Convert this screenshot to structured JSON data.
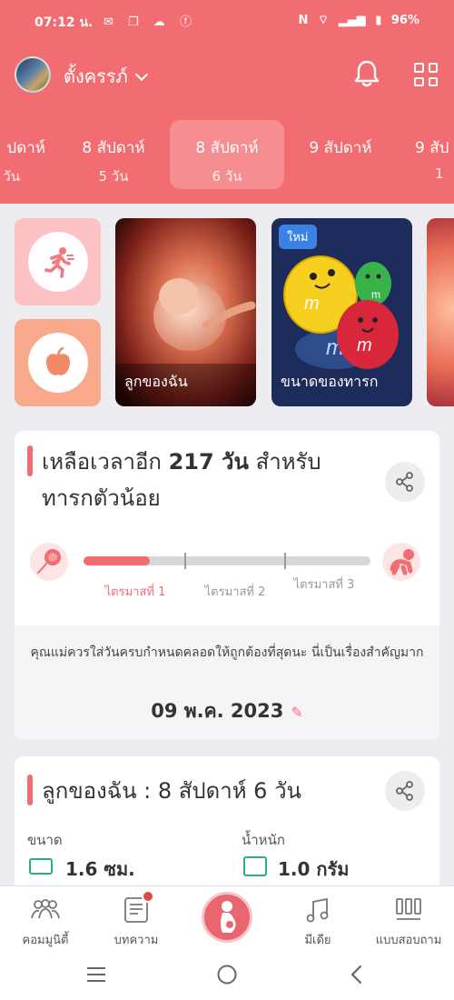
{
  "status_bar": {
    "time": "07:12 น.",
    "network": "N",
    "battery": "96%"
  },
  "header": {
    "title": "ตั้งครรภ์",
    "weeks": [
      {
        "week": "ปดาห์",
        "day": "วัน"
      },
      {
        "week": "8 สัปดาห์",
        "day": "5 วัน"
      },
      {
        "week": "8 สัปดาห์",
        "day": "6 วัน",
        "active": true
      },
      {
        "week": "9 สัปดาห์",
        "day": ""
      },
      {
        "week": "9 สัป",
        "day": "1"
      }
    ]
  },
  "cards": {
    "my_baby": "ลูกของฉัน",
    "baby_size": "ขนาดของทารก",
    "new_badge": "ใหม่"
  },
  "countdown": {
    "title_prefix": "เหลือเวลาอีก",
    "days_bold": "217 วัน",
    "title_suffix": "สำหรับ",
    "title_line2": "ทารกตัวน้อย",
    "progress_fraction": 0.23,
    "trimesters": [
      "ไตรมาสที่ 1",
      "ไตรมาสที่ 2",
      "ไตรมาสที่ 3"
    ],
    "note": "คุณแม่ควรใส่วันครบกำหนดคลอดให้ถูกต้องที่สุดนะ นี่เป็นเรื่องสำคัญมาก",
    "due_date": "09 พ.ค. 2023"
  },
  "baby_card": {
    "title": "ลูกของฉัน : 8 สัปดาห์ 6 วัน",
    "size_label": "ขนาด",
    "size_value": "1.6 ซม.",
    "weight_label": "น้ำหนัก",
    "weight_value": "1.0 กรัม"
  },
  "bottom_nav": {
    "community": "คอมมูนิตี้",
    "articles": "บทความ",
    "media": "มีเดีย",
    "quiz": "แบบสอบถาม"
  },
  "colors": {
    "brand": "#f26d72",
    "accent_green": "#2eae7a"
  }
}
